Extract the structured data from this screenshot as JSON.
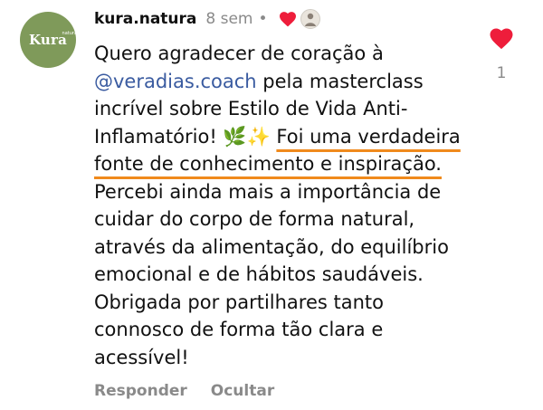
{
  "avatar": {
    "logo_text": "Kura",
    "logo_sub": "natura",
    "color": "#7f9a5a"
  },
  "header": {
    "username": "kura.natura",
    "timestamp": "8 sem",
    "dot": "•"
  },
  "comment": {
    "part1": "Quero agradecer de coração à ",
    "mention": "@veradias.coach",
    "part2": " pela masterclass incrível sobre Estilo de Vida Anti-Inflamatório! 🌿✨ ",
    "highlight": "Foi uma verdadeira fonte de conhecimento e inspiração.",
    "part3": " Percebi ainda mais a importância de cuidar do corpo de forma natural, através da alimentação, do equilíbrio emocional e de hábitos saudáveis. Obrigada por partilhares tanto connosco de forma tão clara e acessível!"
  },
  "actions": {
    "reply": "Responder",
    "hide": "Ocultar"
  },
  "likes": {
    "count": "1"
  },
  "colors": {
    "heart": "#ee1d3b",
    "highlight_underline": "#f08a1c",
    "mention": "#3a5ba0",
    "muted": "#8a8a8a"
  },
  "icons": {
    "like": "heart-icon",
    "liked_by": "heart-icon"
  }
}
